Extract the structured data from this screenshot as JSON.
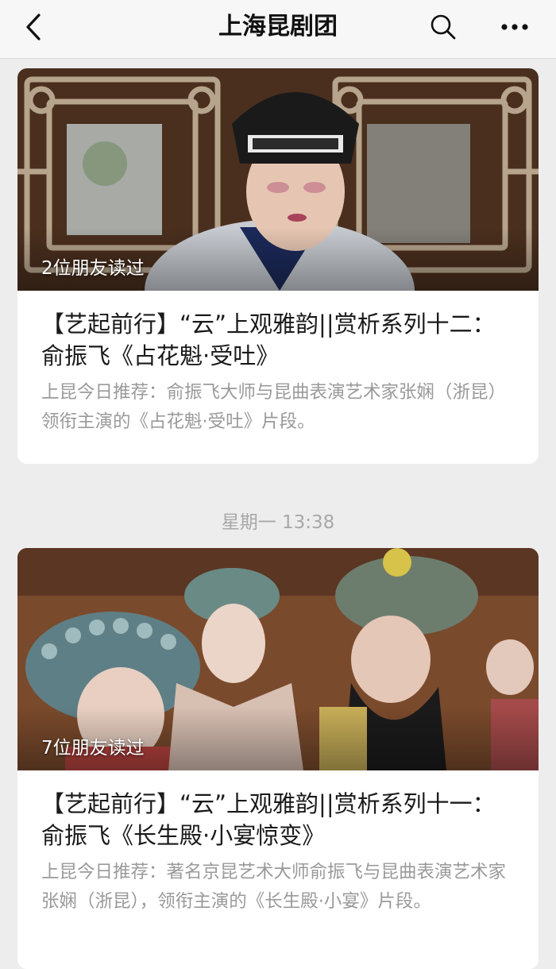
{
  "navbar": {
    "title": "上海昆剧团",
    "back_icon": "chevron-left-icon",
    "search_icon": "search-icon",
    "more_icon": "more-dots-icon"
  },
  "articles": [
    {
      "read_badge": "2位朋友读过",
      "title": "【艺起前行】“云”上观雅韵||赏析系列十二：俞振飞《占花魁·受吐》",
      "description": "上昆今日推荐：俞振飞大师与昆曲表演艺术家张娴（浙昆）领衔主演的《占花魁·受吐》片段。"
    },
    {
      "read_badge": "7位朋友读过",
      "title": "【艺起前行】“云”上观雅韵||赏析系列十一：俞振飞《长生殿·小宴惊变》",
      "description": "上昆今日推荐：著名京昆艺术大师俞振飞与昆曲表演艺术家张娴（浙昆），领衔主演的《长生殿·小宴》片段。"
    }
  ],
  "timestamp": "星期一 13:38",
  "colors": {
    "background": "#ededed",
    "card": "#ffffff",
    "title_text": "#1a1a1a",
    "desc_text": "#9a9a9a",
    "timestamp_text": "#a8a8a8"
  }
}
